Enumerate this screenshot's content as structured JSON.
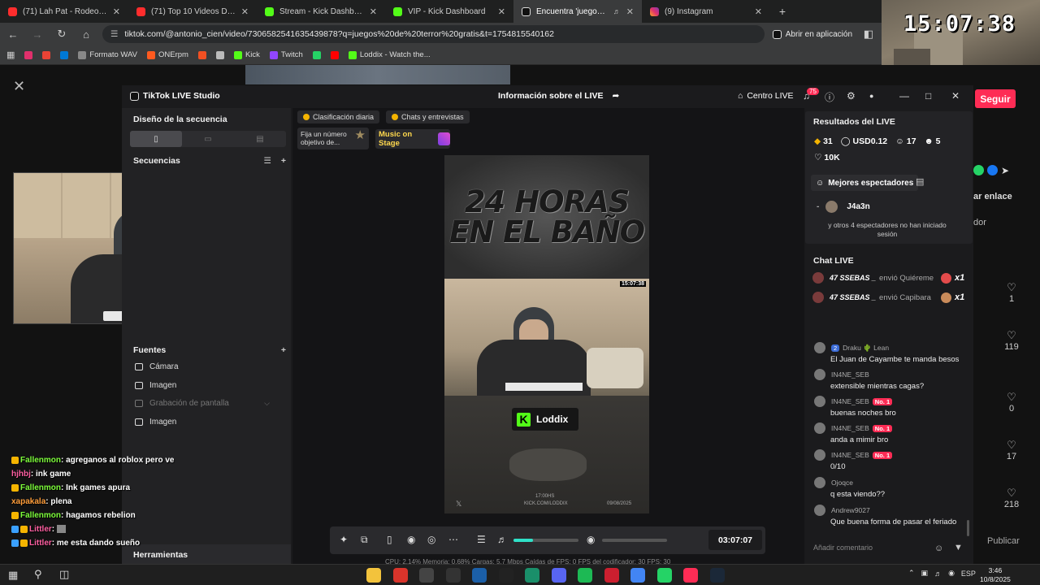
{
  "browser": {
    "tabs": [
      {
        "label": "(71) Lah Pat - Rodeo (feat. Flo M",
        "icon": "youtube",
        "active": false
      },
      {
        "label": "(71) Top 10 Videos De FANTASMA",
        "icon": "youtube",
        "active": false
      },
      {
        "label": "Stream - Kick Dashboard",
        "icon": "kick",
        "active": false
      },
      {
        "label": "VIP - Kick Dashboard",
        "icon": "kick",
        "active": false
      },
      {
        "label": "Encuentra 'juegos de terror",
        "icon": "tiktok",
        "active": true
      },
      {
        "label": "(9) Instagram",
        "icon": "instagram",
        "active": false
      }
    ],
    "url": "tiktok.com/@antonio_cien/video/7306582541635439878?q=juegos%20de%20terror%20gratis&t=1754815540162",
    "open_in_app": "Abrir en aplicación",
    "bookmarks": [
      {
        "label": "",
        "color": "#e1306c"
      },
      {
        "label": "",
        "color": "#ea4335"
      },
      {
        "label": "",
        "color": "#0078d4"
      },
      {
        "label": "Formato WAV",
        "color": "#888888"
      },
      {
        "label": "ONErpm",
        "color": "#ff5a1f"
      },
      {
        "label": "",
        "color": "#f25022"
      },
      {
        "label": "",
        "color": "#bbbbbb"
      },
      {
        "label": "Kick",
        "color": "#53fc18"
      },
      {
        "label": "Twitch",
        "color": "#9146ff"
      },
      {
        "label": "",
        "color": "#25d366"
      },
      {
        "label": "",
        "color": "#ff0000"
      },
      {
        "label": "Loddix - Watch the...",
        "color": "#53fc18"
      }
    ]
  },
  "overlay_clock": "15:07:38",
  "tiktok_page": {
    "follow_button": "Seguir",
    "copy_link": "ar enlace",
    "creator": "dor",
    "likes": [
      "1",
      "119",
      "0",
      "17",
      "218"
    ],
    "publish": "Publicar"
  },
  "studio": {
    "app_title": "TikTok LIVE Studio",
    "center_title": "Información sobre el LIVE",
    "centro_live": "Centro LIVE",
    "notif_count": "75",
    "layout_heading": "Diseño de la secuencia",
    "sequences_heading": "Secuencias",
    "sources_heading": "Fuentes",
    "sources": [
      {
        "label": "Cámara",
        "dim": false
      },
      {
        "label": "Imagen",
        "dim": false
      },
      {
        "label": "Grabación de pantalla",
        "dim": true
      },
      {
        "label": "Imagen",
        "dim": false
      }
    ],
    "tools_heading": "Herramientas",
    "pill_daily": "Clasificación diaria",
    "pill_chats": "Chats y entrevistas",
    "widget_goal": "Fija un número objetivo de...",
    "widget_music": "Music on Stage",
    "video_title_line1": "24 HORAS",
    "video_title_line2": "EN EL BAÑO",
    "video_cam_clock": "15:07:38",
    "video_brand": "Loddix",
    "video_footer_time": "17:00HS",
    "video_footer_site": "KICK.COM/LODDIX",
    "video_footer_date": "09/08/2025",
    "timer": "03:07:07",
    "stats_bar": "CPU: 2.14%   Memoria: 0.68%   Cargas: 5.7 Mbps   Caídas de FPS: 0   FPS del codificador: 30   FPS: 30",
    "results_heading": "Resultados del LIVE",
    "results": {
      "diamonds": "31",
      "usd": "USD0.12",
      "viewers": "17",
      "new": "5",
      "likes": "10K"
    },
    "top_viewers_label": "Mejores espectadores",
    "top_viewer_dash": "-",
    "top_viewer_name": "J4a3n",
    "others_text": "y otros 4 espectadores no han iniciado sesión",
    "chat_heading": "Chat LIVE",
    "gifts": [
      {
        "name": "47 SSEBAS _",
        "sent": "envió Quiéreme",
        "mult": "x1"
      },
      {
        "name": "47 SSEBAS _",
        "sent": "envió Capibara",
        "mult": "x1"
      }
    ],
    "chat": [
      {
        "user": "Draku 🌵 Lean",
        "badge": "2",
        "top": "",
        "text": "El Juan de Cayambe te manda besos"
      },
      {
        "user": "IN4NE_SEB",
        "badge": "",
        "top": "",
        "text": "extensible mientras cagas?"
      },
      {
        "user": "IN4NE_SEB",
        "badge": "",
        "top": "No. 1",
        "text": "buenas noches bro"
      },
      {
        "user": "IN4NE_SEB",
        "badge": "",
        "top": "No. 1",
        "text": "anda a mimir bro"
      },
      {
        "user": "IN4NE_SEB",
        "badge": "",
        "top": "No. 1",
        "text": "0/10"
      },
      {
        "user": "Ojoqce",
        "badge": "",
        "top": "",
        "text": "q esta viendo??"
      },
      {
        "user": "Andrew9027",
        "badge": "",
        "top": "",
        "text": "Que buena forma de pasar el feriado"
      }
    ],
    "comment_placeholder": "Añadir comentario"
  },
  "stream_chat_overlay": [
    {
      "user": "Fallenmon",
      "color": "#7cfc3a",
      "msg": ": agreganos al roblox pero ve",
      "badge": "y"
    },
    {
      "user": "hjhbj",
      "color": "#ff5fa2",
      "msg": ": ink game",
      "badge": ""
    },
    {
      "user": "Fallenmon",
      "color": "#7cfc3a",
      "msg": ": Ink games apura",
      "badge": "y"
    },
    {
      "user": "xapakala",
      "color": "#ff9d3a",
      "msg": ": plena",
      "badge": ""
    },
    {
      "user": "Fallenmon",
      "color": "#7cfc3a",
      "msg": ": hagamos rebelion",
      "badge": "y"
    },
    {
      "user": "Littler",
      "color": "#ff5fa2",
      "msg": ":",
      "badge": "b"
    },
    {
      "user": "Littler",
      "color": "#ff5fa2",
      "msg": ": me esta dando sueño",
      "badge": "b"
    }
  ],
  "taskbar": {
    "lang": "ESP",
    "time": "3:46",
    "date": "10/8/2025",
    "apps": [
      {
        "color": "#f3c33c"
      },
      {
        "color": "#d9342b"
      },
      {
        "color": "#444444"
      },
      {
        "color": "#333333"
      },
      {
        "color": "#1b5fa8"
      },
      {
        "color": "#222222"
      },
      {
        "color": "#1a8f6a"
      },
      {
        "color": "#5865f2"
      },
      {
        "color": "#1db954"
      },
      {
        "color": "#cc1f2f"
      },
      {
        "color": "#4285f4"
      },
      {
        "color": "#25d366"
      },
      {
        "color": "#fe2c55"
      },
      {
        "color": "#1b2838"
      }
    ]
  }
}
